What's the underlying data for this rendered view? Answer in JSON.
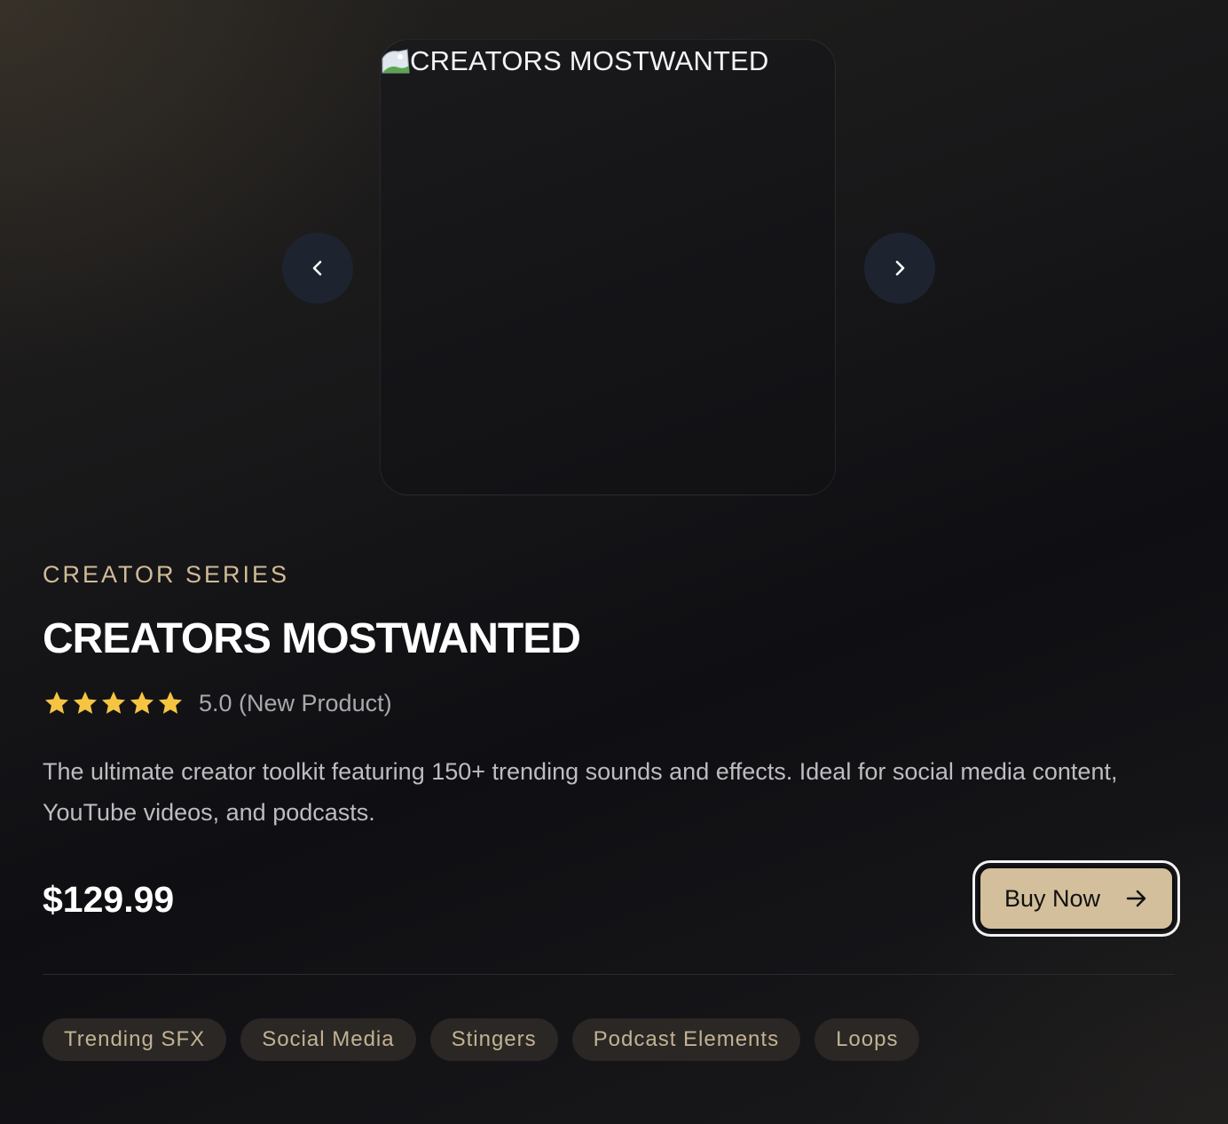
{
  "gallery": {
    "image_alt": "CREATORS MOSTWANTED",
    "prev_icon": "chevron-left-icon",
    "next_icon": "chevron-right-icon"
  },
  "product": {
    "series": "CREATOR SERIES",
    "title": "CREATORS MOSTWANTED",
    "rating": {
      "stars": 5,
      "max_stars": 5,
      "text": "5.0 (New Product)"
    },
    "description": "The ultimate creator toolkit featuring 150+ trending sounds and effects. Ideal for social media content, YouTube videos, and podcasts.",
    "price": "$129.99",
    "buy_label": "Buy Now",
    "buy_icon": "arrow-right-icon"
  },
  "tags": [
    "Trending SFX",
    "Social Media",
    "Stingers",
    "Podcast Elements",
    "Loops"
  ],
  "colors": {
    "accent": "#d3bf9b",
    "series_label": "#d1bc97",
    "star": "#f5c542",
    "nav_button": "#1d2430",
    "tag_bg": "#2a2724"
  }
}
